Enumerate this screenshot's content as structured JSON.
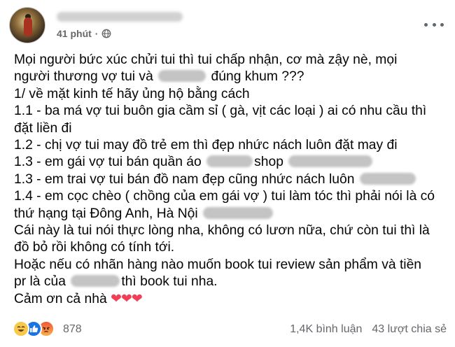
{
  "post": {
    "time": "41 phút",
    "separator": "·",
    "lines": {
      "l1": "Mọi người bức xúc chửi tui thì tui chấp nhận, cơ mà zậy nè, mọi",
      "l2a": "người thương vợ tui và",
      "l2b": "đúng khum ???",
      "l3": "1/ về mặt kinh tế hãy ủng hộ bằng cách",
      "l4": "1.1 - ba má vợ tui buôn gia cầm sỉ ( gà, vịt các loại ) ai có nhu cầu thì",
      "l5": "đặt liền đi",
      "l6": "1.2 - chị vợ tui may đồ trẻ em thì đẹp nhức nách luôn đặt may đi",
      "l7a": "1.3 - em gái vợ tui bán quần áo",
      "l7b": "shop",
      "l8": "1.3 - em trai vợ tui bán đồ nam đẹp cũng nhức nách luôn",
      "l9": "1.4 - em cọc chèo ( chồng của em gái vợ ) tui làm tóc thì phải nói là có",
      "l10": "thứ hạng tại Đông Anh, Hà Nội",
      "l11": "Cái này là tui nói thực lòng nha, không có lươn nữa, chứ còn tui thì là",
      "l12": "đồ bỏ rồi không có tính tới.",
      "l13": "Hoặc nếu có nhãn hàng nào muốn book tui review sản phẩm và tiền",
      "l14a": "pr là của",
      "l14b": "thì book tui nha.",
      "l15": "Cảm ơn cả nhà",
      "hearts": "❤❤❤"
    }
  },
  "footer": {
    "reaction_count": "878",
    "comments": "1,4K bình luận",
    "shares": "43 lượt chia sẻ"
  },
  "icons": {
    "privacy": "globe-icon",
    "menu": "more-options-icon",
    "reactions": [
      "haha-reaction-icon",
      "like-reaction-icon",
      "angry-reaction-icon"
    ]
  },
  "colors": {
    "text": "#050505",
    "meta": "#65676b",
    "heart": "#f33e58",
    "like": "#1b74e4",
    "haha": "#f7c94b"
  }
}
